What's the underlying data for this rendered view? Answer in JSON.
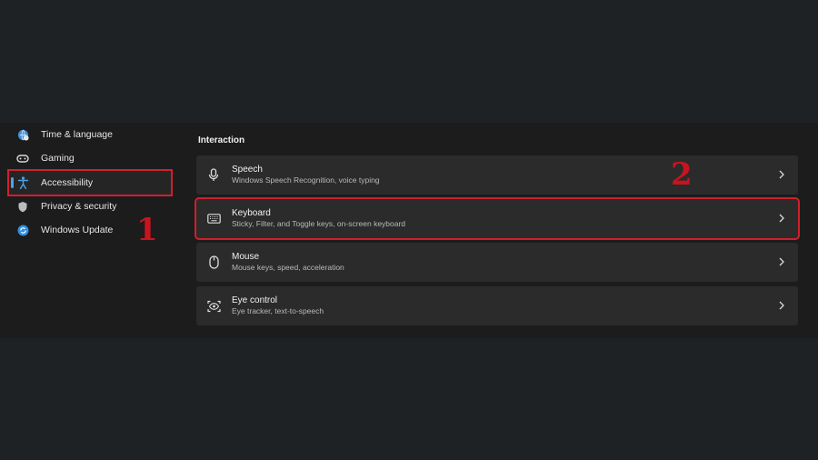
{
  "sidebar": {
    "items": [
      {
        "label": "Time & language",
        "icon": "globe-clock-icon"
      },
      {
        "label": "Gaming",
        "icon": "gamepad-icon"
      },
      {
        "label": "Accessibility",
        "icon": "accessibility-icon",
        "selected": true
      },
      {
        "label": "Privacy & security",
        "icon": "shield-icon"
      },
      {
        "label": "Windows Update",
        "icon": "refresh-icon"
      }
    ]
  },
  "main": {
    "section_title": "Interaction",
    "cards": [
      {
        "title": "Speech",
        "desc": "Windows Speech Recognition, voice typing",
        "icon": "microphone-icon"
      },
      {
        "title": "Keyboard",
        "desc": "Sticky, Filter, and Toggle keys, on-screen keyboard",
        "icon": "keyboard-icon",
        "highlighted": true
      },
      {
        "title": "Mouse",
        "desc": "Mouse keys, speed, acceleration",
        "icon": "mouse-icon"
      },
      {
        "title": "Eye control",
        "desc": "Eye tracker, text-to-speech",
        "icon": "eye-control-icon"
      }
    ]
  },
  "annotations": {
    "step1": "1",
    "step2": "2"
  },
  "colors": {
    "highlight": "#d01f2b",
    "annotation": "#c8141f",
    "accent": "#4aa3e8"
  }
}
